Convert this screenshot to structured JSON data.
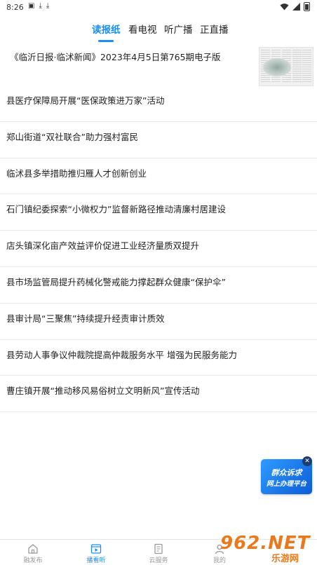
{
  "status_bar": {
    "time": "8:26"
  },
  "tabs": [
    {
      "label": "读报纸",
      "active": true
    },
    {
      "label": "看电视",
      "active": false
    },
    {
      "label": "听广播",
      "active": false
    },
    {
      "label": "正直播",
      "active": false
    }
  ],
  "epaper": {
    "title": "《临沂日报·临沭新闻》2023年4月5日第765期电子版"
  },
  "news": [
    "县医疗保障局开展“医保政策进万家”活动",
    "郑山街道“双社联合”助力强村富民",
    "临沭县多举措助推归雁人才创新创业",
    "石门镇纪委探索“小微权力”监督新路径推动清廉村居建设",
    "店头镇深化亩产效益评价促进工业经济量质双提升",
    "县市场监管局提升药械化警戒能力撑起群众健康“保护伞”",
    "县审计局“三聚焦”持续提升经责审计质效",
    "县劳动人事争议仲裁院提高仲裁服务水平  增强为民服务能力",
    "曹庄镇开展“推动移风易俗树立文明新风”宣传活动"
  ],
  "float_ad": {
    "line1": "群众诉求",
    "line2": "网上办理平台"
  },
  "bottom_nav": [
    {
      "label": "融发布",
      "icon": "home-icon",
      "active": false
    },
    {
      "label": "播看听",
      "icon": "video-icon",
      "active": true
    },
    {
      "label": "云服务",
      "icon": "service-icon",
      "active": false
    },
    {
      "label": "我的",
      "icon": "user-icon",
      "active": false
    }
  ],
  "watermark": {
    "brand": "962.NET",
    "sub": "乐游网"
  },
  "colors": {
    "accent": "#1a8ff2",
    "divider": "#e9e9e9",
    "watermark": "#e87a1e"
  }
}
